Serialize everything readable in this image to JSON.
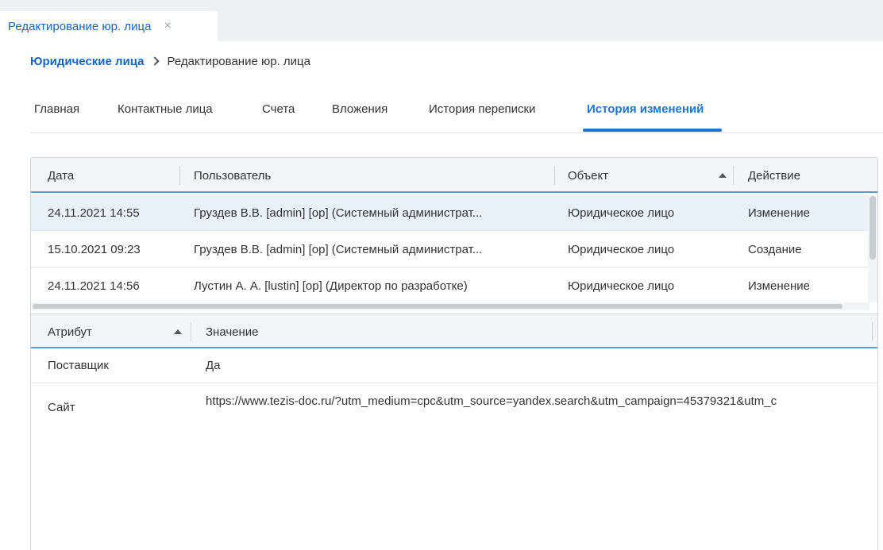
{
  "window_tab": {
    "label": "Редактирование юр. лица",
    "close_glyph": "×"
  },
  "breadcrumb": {
    "parent": "Юридические лица",
    "separator_icon": "chevron-right-icon",
    "current": "Редактирование юр. лица"
  },
  "tabs": [
    {
      "label": "Главная",
      "active": false
    },
    {
      "label": "Контактные лица",
      "active": false
    },
    {
      "label": "Счета",
      "active": false
    },
    {
      "label": "Вложения",
      "active": false
    },
    {
      "label": "История переписки",
      "active": false
    },
    {
      "label": "История изменений",
      "active": true
    }
  ],
  "history_grid": {
    "columns": {
      "date": "Дата",
      "user": "Пользователь",
      "object": "Объект",
      "action": "Действие"
    },
    "sorted_column": "object",
    "sort_direction": "ascending",
    "rows": [
      {
        "date": "24.11.2021 14:55",
        "user": "Груздев В.В. [admin] [op] (Системный администрат...",
        "object": "Юридическое лицо",
        "action": "Изменение",
        "selected": true
      },
      {
        "date": "15.10.2021 09:23",
        "user": "Груздев В.В. [admin] [op] (Системный администрат...",
        "object": "Юридическое лицо",
        "action": "Создание",
        "selected": false
      },
      {
        "date": "24.11.2021 14:56",
        "user": "Лустин А. А. [lustin] [op] (Директор по разработке)",
        "object": "Юридическое лицо",
        "action": "Изменение",
        "selected": false
      }
    ]
  },
  "attributes_grid": {
    "columns": {
      "attribute": "Атрибут",
      "value": "Значение"
    },
    "sorted_column": "attribute",
    "sort_direction": "ascending",
    "rows": [
      {
        "attribute": "Поставщик",
        "value": "Да"
      },
      {
        "attribute": "Сайт",
        "value": "https://www.tezis-doc.ru/?utm_medium=cpc&utm_source=yandex.search&utm_campaign=45379321&utm_c"
      }
    ]
  },
  "colors": {
    "accent": "#1976d2",
    "link": "#1565c0",
    "selected_row": "#e9f1fb",
    "header_underline": "#5b9bd5"
  }
}
